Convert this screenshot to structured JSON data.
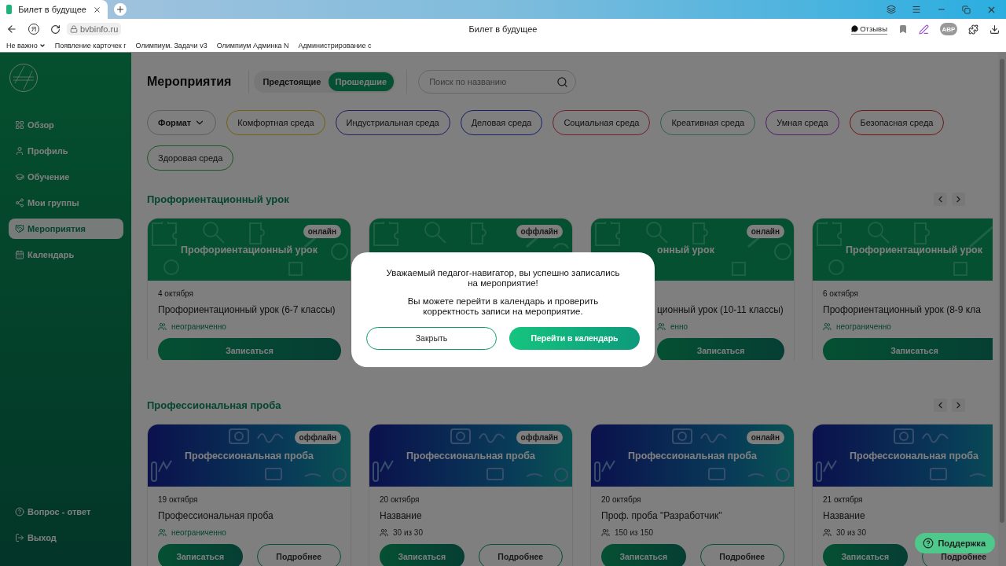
{
  "browser": {
    "tab_title": "Билет в будущее",
    "yandex": "Я",
    "url": "bvbinfo.ru",
    "page_title": "Билет в будущее",
    "reviews": "Отзывы",
    "abp": "ABP",
    "bookmarks": [
      {
        "label": "Не важно",
        "kind": "folder"
      },
      {
        "label": "Появление карточек г",
        "kind": "link"
      },
      {
        "label": "Олимпиум. Задачи v3",
        "kind": "link"
      },
      {
        "label": "Олимпиум Админка N",
        "kind": "link"
      },
      {
        "label": "Администрирование с",
        "kind": "link"
      }
    ]
  },
  "sidebar": {
    "items": [
      {
        "label": "Обзор",
        "selected": false
      },
      {
        "label": "Профиль",
        "selected": false
      },
      {
        "label": "Обучение",
        "selected": false
      },
      {
        "label": "Мои группы",
        "selected": false
      },
      {
        "label": "Мероприятия",
        "selected": true
      },
      {
        "label": "Календарь",
        "selected": false
      }
    ],
    "bottom_items": [
      {
        "label": "Вопрос - ответ"
      },
      {
        "label": "Выход"
      }
    ]
  },
  "page": {
    "title": "Мероприятия",
    "toggle": [
      {
        "label": "Предстоящие",
        "selected": false
      },
      {
        "label": "Прошедшие",
        "selected": true
      }
    ],
    "search": {
      "placeholder": "Поиск по названию"
    },
    "format_filter": "Формат",
    "tags": [
      {
        "label": "Комфортная среда",
        "color": "#74610d"
      },
      {
        "label": "Индустриальная среда",
        "color": "#251f64"
      },
      {
        "label": "Деловая среда",
        "color": "#152268"
      },
      {
        "label": "Социальная среда",
        "color": "#70202d"
      },
      {
        "label": "Креативная среда",
        "color": "#2e6054"
      },
      {
        "label": "Умная среда",
        "color": "#541e68"
      },
      {
        "label": "Безопасная среда",
        "color": "#6c1810"
      },
      {
        "label": "Здоровая среда",
        "color": "#1e5822"
      }
    ],
    "sections": [
      {
        "title": "Профориентационный урок",
        "kind": "lesson",
        "cards": [
          {
            "format": "онлайн",
            "banner_title": "Профориентационный урок",
            "date": "4 октября",
            "title": "Профориентационный урок (6-7 классы)",
            "capacity": "неограниченно",
            "unlimited": true,
            "buttons": [
              {
                "label": "Записаться",
                "kind": "primary"
              }
            ]
          },
          {
            "format": "оффлайн"
          },
          {
            "format": "онлайн",
            "cut_left": true,
            "banner_title": "онный урок",
            "title": "ционный урок (10-11 классы)",
            "capacity": "енно",
            "unlimited": true,
            "buttons": [
              {
                "label": "Записаться",
                "kind": "primary"
              }
            ]
          },
          {
            "banner_title": "Профориентационный урок",
            "date": "6 октября",
            "title": "Профориентационный урок (8-9 кла",
            "capacity": "неограниченно",
            "unlimited": true,
            "buttons": [
              {
                "label": "Записаться",
                "kind": "primary"
              }
            ]
          }
        ]
      },
      {
        "title": "Профессиональная проба",
        "kind": "trial",
        "cards": [
          {
            "format": "оффлайн",
            "banner_title": "Профессиональная проба",
            "date": "19 октября",
            "title": "Профессиональная проба",
            "capacity": "неограниченно",
            "unlimited": true,
            "buttons": [
              {
                "label": "Записаться",
                "kind": "primary"
              },
              {
                "label": "Подробнее",
                "kind": "outline"
              }
            ]
          },
          {
            "format": "оффлайн",
            "banner_title": "Профессиональная проба",
            "date": "20 октября",
            "title": "Название",
            "capacity": "30 из 30",
            "unlimited": false,
            "buttons": [
              {
                "label": "Записаться",
                "kind": "primary"
              },
              {
                "label": "Подробнее",
                "kind": "outline"
              }
            ]
          },
          {
            "format": "онлайн",
            "banner_title": "Профессиональная проба",
            "date": "20 октября",
            "title": "Проф. проба \"Разработчик\"",
            "capacity": "150 из 150",
            "unlimited": false,
            "buttons": [
              {
                "label": "Записаться",
                "kind": "primary"
              },
              {
                "label": "Подробнее",
                "kind": "outline"
              }
            ]
          },
          {
            "banner_title": "Профессиональная проба",
            "date": "21 октября",
            "title": "Название",
            "capacity": "30 из 30",
            "unlimited": false,
            "buttons": [
              {
                "label": "Записаться",
                "kind": "primary"
              },
              {
                "label": "Подробнее",
                "kind": "outline"
              }
            ]
          }
        ]
      }
    ]
  },
  "modal": {
    "message": "Уважаемый педагог-навигатор, вы успешно записались на мероприятие!",
    "hint": "Вы можете перейти в календарь и проверить корректность записи на мероприятие.",
    "buttons": [
      {
        "label": "Закрыть",
        "kind": "outline"
      },
      {
        "label": "Перейти в календарь",
        "kind": "primary"
      }
    ]
  },
  "support_button": "Поддержка"
}
